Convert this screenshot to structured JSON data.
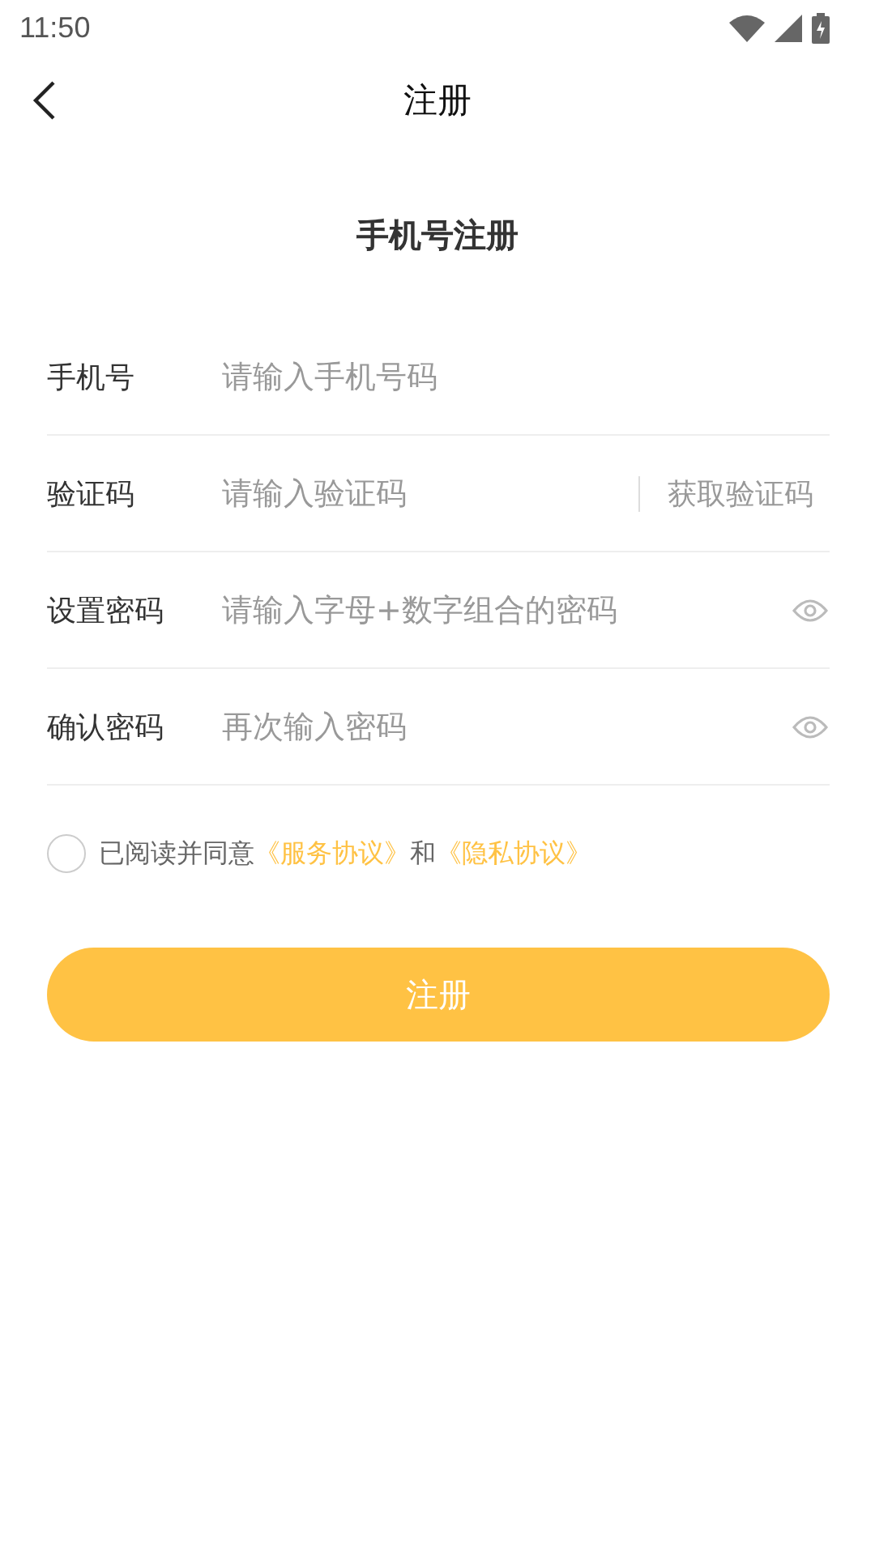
{
  "status_bar": {
    "time": "11:50"
  },
  "nav": {
    "title": "注册"
  },
  "heading": "手机号注册",
  "fields": [
    {
      "kind": "text",
      "label": "手机号",
      "placeholder": "请输入手机号码"
    },
    {
      "kind": "code",
      "label": "验证码",
      "placeholder": "请输入验证码",
      "action": "获取验证码"
    },
    {
      "kind": "password",
      "label": "设置密码",
      "placeholder": "请输入字母+数字组合的密码"
    },
    {
      "kind": "password",
      "label": "确认密码",
      "placeholder": "再次输入密码"
    }
  ],
  "agreement": {
    "checked": false,
    "prefix": "已阅读并同意",
    "link_1": "《服务协议》",
    "joiner": "和",
    "link_2": "《隐私协议》"
  },
  "submit": "注册"
}
